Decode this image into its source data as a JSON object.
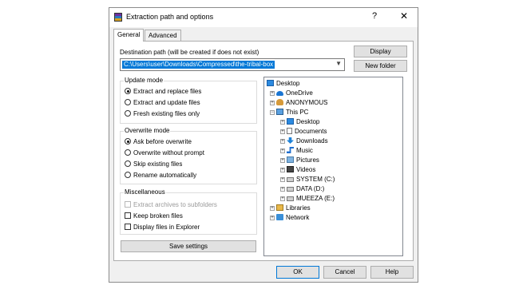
{
  "window": {
    "title": "Extraction path and options",
    "help": "?",
    "close": "✕"
  },
  "tabs": [
    {
      "label": "General"
    },
    {
      "label": "Advanced"
    }
  ],
  "destination": {
    "label": "Destination path (will be created if does not exist)",
    "value": "C:\\Users\\user\\Downloads\\Compressed\\the-tribal-box",
    "display_button": "Display",
    "new_folder_button": "New folder"
  },
  "update_mode": {
    "title": "Update mode",
    "options": [
      "Extract and replace files",
      "Extract and update files",
      "Fresh existing files only"
    ],
    "selected": 0
  },
  "overwrite_mode": {
    "title": "Overwrite mode",
    "options": [
      "Ask before overwrite",
      "Overwrite without prompt",
      "Skip existing files",
      "Rename automatically"
    ],
    "selected": 0
  },
  "misc": {
    "title": "Miscellaneous",
    "options": [
      {
        "label": "Extract archives to subfolders",
        "checked": false,
        "disabled": true
      },
      {
        "label": "Keep broken files",
        "checked": false,
        "disabled": false
      },
      {
        "label": "Display files in Explorer",
        "checked": false,
        "disabled": false
      }
    ]
  },
  "save_button": "Save settings",
  "tree": {
    "root": "Desktop",
    "items": [
      "OneDrive",
      "ANONYMOUS",
      "This PC",
      "Desktop",
      "Documents",
      "Downloads",
      "Music",
      "Pictures",
      "Videos",
      "SYSTEM (C:)",
      "DATA (D:)",
      "MUEEZA (E:)",
      "Libraries",
      "Network"
    ],
    "expander": "+",
    "collapser": "−"
  },
  "footer": {
    "ok": "OK",
    "cancel": "Cancel",
    "help": "Help"
  }
}
